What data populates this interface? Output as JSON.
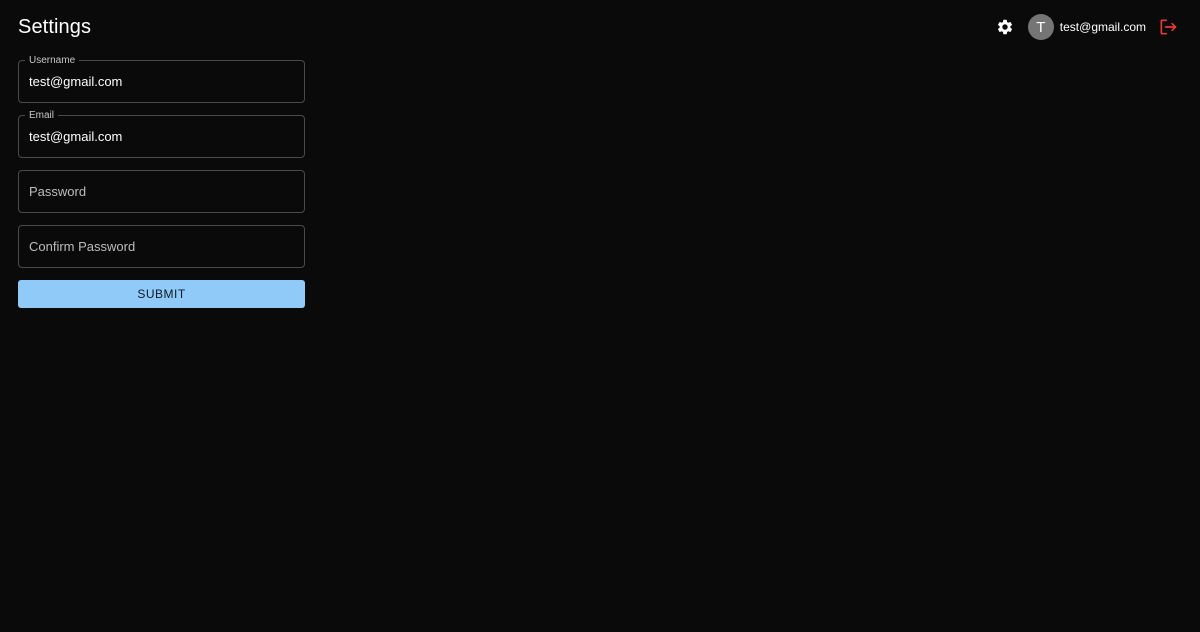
{
  "header": {
    "title": "Settings",
    "user": {
      "avatar_initial": "T",
      "email": "test@gmail.com"
    },
    "icons": {
      "settings": "gear-icon",
      "logout": "logout-icon"
    }
  },
  "form": {
    "username": {
      "label": "Username",
      "value": "test@gmail.com"
    },
    "email": {
      "label": "Email",
      "value": "test@gmail.com"
    },
    "password": {
      "placeholder": "Password",
      "value": ""
    },
    "confirm_password": {
      "placeholder": "Confirm Password",
      "value": ""
    },
    "submit_label": "SUBMIT"
  },
  "colors": {
    "background": "#0a0a0a",
    "primary": "#90caf9",
    "logout": "#e53935",
    "avatar": "#757575",
    "field_border": "#4a4a4a"
  }
}
